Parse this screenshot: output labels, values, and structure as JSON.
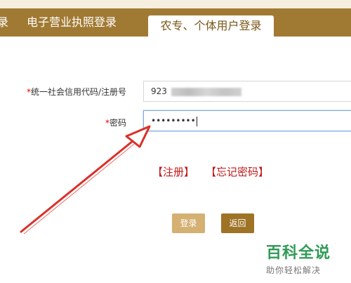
{
  "tabs": {
    "partial": "录",
    "license": "电子营业执照登录",
    "farmer": "农专、个体用户登录"
  },
  "form": {
    "credit_label_required": "*",
    "credit_label": "统一社会信用代码/注册号",
    "credit_value_visible": "923",
    "password_label_required": "*",
    "password_label": "密码",
    "password_value": "•••••••••"
  },
  "links": {
    "register": "【注册】",
    "forgot": "【忘记密码】"
  },
  "buttons": {
    "login": "登录",
    "back": "返回"
  },
  "watermark": {
    "title": "百科全说",
    "subtitle": "助你轻松解决"
  },
  "colors": {
    "tab_bar": "#a07a33",
    "required": "#e60000",
    "link": "#c01a1a",
    "login_button": "#d4b072",
    "back_button": "#9e7326",
    "arrow": "#d9302a",
    "watermark": "#2f9a56"
  }
}
